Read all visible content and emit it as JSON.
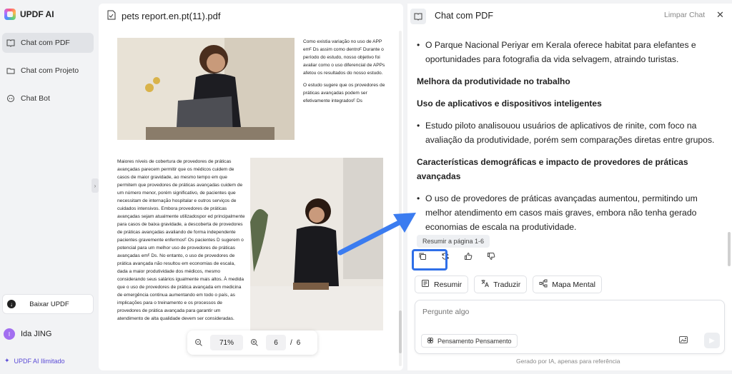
{
  "app": {
    "name": "UPDF AI"
  },
  "sidebar": {
    "items": [
      {
        "label": "Chat com PDF",
        "icon": "book-icon"
      },
      {
        "label": "Chat com Projeto",
        "icon": "folder-icon"
      },
      {
        "label": "Chat Bot",
        "icon": "bot-icon"
      }
    ],
    "download_label": "Baixar UPDF",
    "user": {
      "initial": "I",
      "name": "Ida JING"
    },
    "unlimited_label": "UPDF AI Ilimitado"
  },
  "pdf": {
    "filename": "pets report.en.pt(11).pdf",
    "para1": "Como existia variação no uso de APP emᴱ Ds assim como dentroᴱ Durante o período do estudo, nosso objetivo foi avaliar como o uso diferencial de APPs afetou os resultados do nosso estudo.",
    "para2": "O estudo sugere que os provedores de práticas avançadas podem ser efetivamente integradosᴱ Ds",
    "para3": "Maiores níveis de cobertura de provedores de práticas avançadas parecem permitir que os médicos cuidem de casos de maior gravidade, ao mesmo tempo em que permitem que provedores de práticas avançadas cuidem de um número menor, porém significativo, de pacientes que necessitam de internação hospitalar e outros serviços de cuidados intensivos. Embora provedores de práticas avançadas sejam atualmente utilizadospor ed principalmente para casos de baixa gravidade, a descoberta de provedores de práticas avançadas avaliando de forma independente pacientes gravemente enfermosᴱ Os pacientes D sugerem o potencial para um melhor uso de provedores de práticas avançadas emᴱ Ds. No entanto, o uso de provedores de prática avançada não resultou em economias de escala, dada a maior produtividade dos médicos, mesmo considerando seus salários igualmente mais altos. À medida que o uso de provedores de prática avançada em medicina de emergência continua aumentando em todo o país, as implicações para o treinamento e os processos de provedores de prática avançada para garantir um atendimento de alta qualidade devem ser consideradas.",
    "zoom": "71%",
    "current_page": "6",
    "page_separator": "/",
    "total_pages": "6"
  },
  "chat": {
    "title": "Chat com PDF",
    "clear_label": "Limpar Chat",
    "bullet1": "O Parque Nacional Periyar em Kerala oferece habitat para elefantes e oportunidades para fotografia da vida selvagem, atraindo turistas.",
    "heading1": "Melhora da produtividade no trabalho",
    "heading2": "Uso de aplicativos e dispositivos inteligentes",
    "bullet2": "Estudo piloto analisouou usuários de aplicativos de rinite, com foco na avaliação da produtividade, porém sem comparações diretas entre grupos.",
    "heading3": "Características demográficas e impacto de provedores de práticas avançadas",
    "bullet3": "O uso de provedores de práticas avançadas aumentou, permitindo um melhor atendimento em casos mais graves, embora não tenha gerado economias de escala na produtividade.",
    "resume_pill": "Resumir a página 1-6",
    "tools": [
      "Resumir",
      "Traduzir",
      "Mapa Mental"
    ],
    "input_placeholder": "Pergunte algo",
    "thinking_label": "Pensamento Pensamento",
    "footer_note": "Gerado por IA, apenas para referência"
  },
  "colors": {
    "highlight": "#2f6fe8",
    "arrow": "#3b7cf0",
    "accent": "#5b4bd6"
  }
}
